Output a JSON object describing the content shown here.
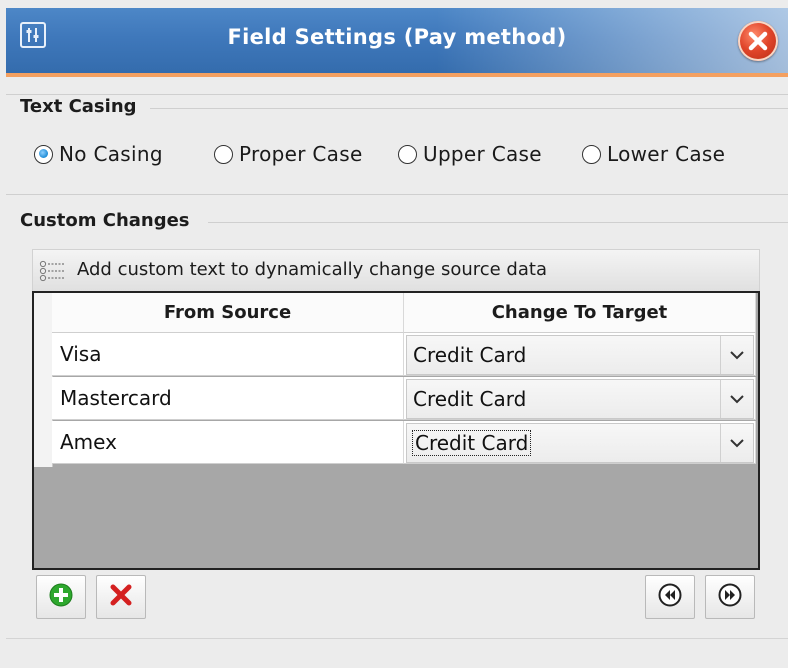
{
  "window": {
    "title": "Field Settings (Pay method)"
  },
  "text_casing": {
    "label": "Text Casing",
    "options": [
      {
        "label": "No Casing",
        "selected": true
      },
      {
        "label": "Proper Case",
        "selected": false
      },
      {
        "label": "Upper Case",
        "selected": false
      },
      {
        "label": "Lower Case",
        "selected": false
      }
    ]
  },
  "custom_changes": {
    "label": "Custom Changes",
    "info": "Add custom text to dynamically change source data",
    "columns": [
      "From Source",
      "Change To Target"
    ],
    "rows": [
      {
        "source": "Visa",
        "target": "Credit Card"
      },
      {
        "source": "Mastercard",
        "target": "Credit Card"
      },
      {
        "source": "Amex",
        "target": "Credit Card"
      }
    ]
  },
  "icons": {
    "app": "settings-sliders-icon",
    "close": "close-icon",
    "list": "list-icon",
    "add": "add-icon",
    "delete": "delete-icon",
    "previous": "previous-icon",
    "next": "next-icon",
    "dropdown": "chevron-down-icon"
  },
  "colors": {
    "titlebar": "#3f78bb",
    "accent_line": "#f4a060",
    "close": "#e0452a",
    "radio_selected": "#1c8bd6",
    "grid_background": "#a7a7a7",
    "add": "#2ea82e",
    "delete": "#d42020"
  }
}
